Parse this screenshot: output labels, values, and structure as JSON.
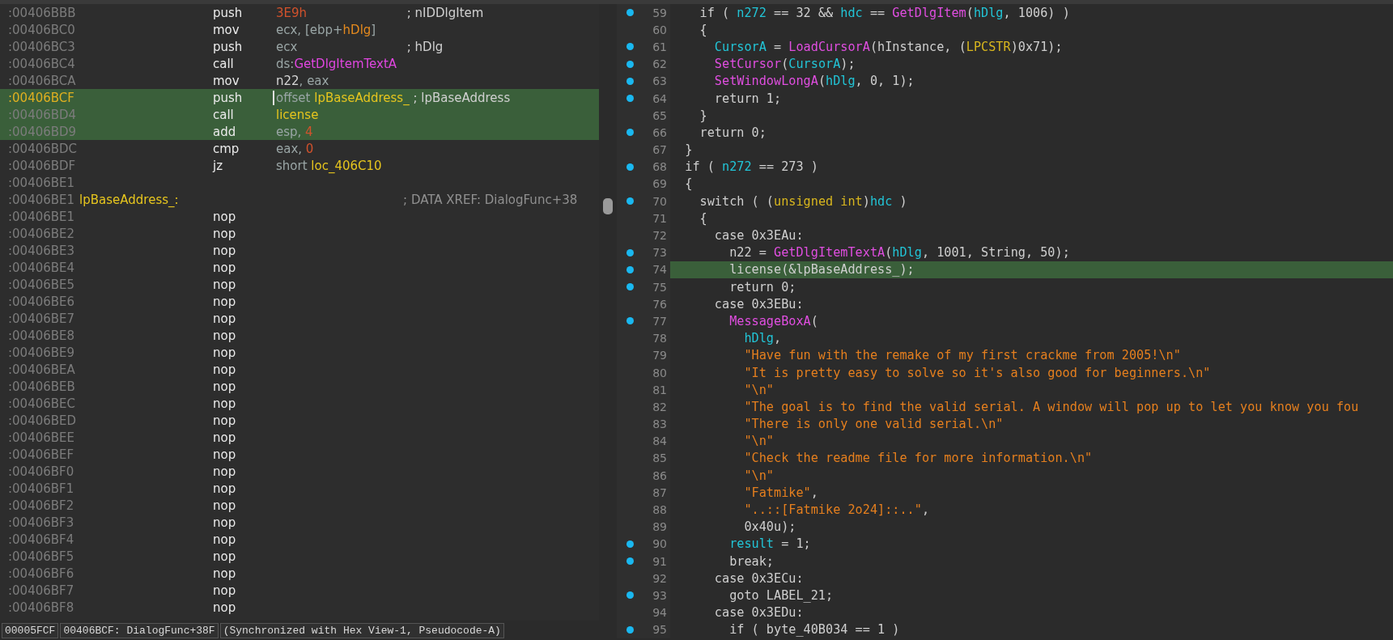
{
  "disassembly": {
    "rows": [
      {
        "address": ":00406BBB",
        "current": false,
        "selected": false,
        "caret": false,
        "mnemonic": "push",
        "operands": [
          {
            "kind": "num",
            "text": "3E9h"
          }
        ],
        "comment": "; nIDDlgItem"
      },
      {
        "address": ":00406BC0",
        "current": false,
        "selected": false,
        "caret": false,
        "mnemonic": "mov",
        "operands": [
          {
            "kind": "reg",
            "text": "ecx, [ebp+"
          },
          {
            "kind": "arg",
            "text": "hDlg"
          },
          {
            "kind": "reg",
            "text": "]"
          }
        ]
      },
      {
        "address": ":00406BC3",
        "current": false,
        "selected": false,
        "caret": false,
        "mnemonic": "push",
        "operands": [
          {
            "kind": "reg",
            "text": "ecx"
          }
        ],
        "comment": "; hDlg"
      },
      {
        "address": ":00406BC4",
        "current": false,
        "selected": false,
        "caret": false,
        "mnemonic": "call",
        "operands": [
          {
            "kind": "reg",
            "text": "ds:"
          },
          {
            "kind": "func",
            "text": "GetDlgItemTextA"
          }
        ]
      },
      {
        "address": ":00406BCA",
        "current": false,
        "selected": false,
        "caret": false,
        "mnemonic": "mov",
        "operands": [
          {
            "kind": "plain",
            "text": "n22"
          },
          {
            "kind": "reg",
            "text": ", eax"
          }
        ]
      },
      {
        "address": ":00406BCF",
        "current": true,
        "selected": true,
        "caret": true,
        "mnemonic": "push",
        "operands": [
          {
            "kind": "reg",
            "text": "offset "
          },
          {
            "kind": "name",
            "text": "lpBaseAddress_"
          }
        ],
        "comment": "; lpBaseAddress"
      },
      {
        "address": ":00406BD4",
        "current": false,
        "selected": true,
        "caret": false,
        "mnemonic": "call",
        "operands": [
          {
            "kind": "name",
            "text": "license"
          }
        ]
      },
      {
        "address": ":00406BD9",
        "current": false,
        "selected": true,
        "caret": false,
        "mnemonic": "add",
        "operands": [
          {
            "kind": "reg",
            "text": "esp, "
          },
          {
            "kind": "num",
            "text": "4"
          }
        ]
      },
      {
        "address": ":00406BDC",
        "current": false,
        "selected": false,
        "caret": false,
        "mnemonic": "cmp",
        "operands": [
          {
            "kind": "reg",
            "text": "eax, "
          },
          {
            "kind": "num",
            "text": "0"
          }
        ]
      },
      {
        "address": ":00406BDF",
        "current": false,
        "selected": false,
        "caret": false,
        "mnemonic": "jz",
        "operands": [
          {
            "kind": "reg",
            "text": "short "
          },
          {
            "kind": "name",
            "text": "loc_406C10"
          }
        ]
      },
      {
        "address": ":00406BE1",
        "current": false,
        "selected": false,
        "caret": false
      },
      {
        "address": ":00406BE1",
        "current": false,
        "selected": false,
        "caret": false,
        "label": "lpBaseAddress_:",
        "comment": "; DATA XREF: DialogFunc+38"
      },
      {
        "address": ":00406BE1",
        "current": false,
        "selected": false,
        "caret": false,
        "mnemonic": "nop"
      },
      {
        "address": ":00406BE2",
        "current": false,
        "selected": false,
        "caret": false,
        "mnemonic": "nop"
      },
      {
        "address": ":00406BE3",
        "current": false,
        "selected": false,
        "caret": false,
        "mnemonic": "nop"
      },
      {
        "address": ":00406BE4",
        "current": false,
        "selected": false,
        "caret": false,
        "mnemonic": "nop"
      },
      {
        "address": ":00406BE5",
        "current": false,
        "selected": false,
        "caret": false,
        "mnemonic": "nop"
      },
      {
        "address": ":00406BE6",
        "current": false,
        "selected": false,
        "caret": false,
        "mnemonic": "nop"
      },
      {
        "address": ":00406BE7",
        "current": false,
        "selected": false,
        "caret": false,
        "mnemonic": "nop"
      },
      {
        "address": ":00406BE8",
        "current": false,
        "selected": false,
        "caret": false,
        "mnemonic": "nop"
      },
      {
        "address": ":00406BE9",
        "current": false,
        "selected": false,
        "caret": false,
        "mnemonic": "nop"
      },
      {
        "address": ":00406BEA",
        "current": false,
        "selected": false,
        "caret": false,
        "mnemonic": "nop"
      },
      {
        "address": ":00406BEB",
        "current": false,
        "selected": false,
        "caret": false,
        "mnemonic": "nop"
      },
      {
        "address": ":00406BEC",
        "current": false,
        "selected": false,
        "caret": false,
        "mnemonic": "nop"
      },
      {
        "address": ":00406BED",
        "current": false,
        "selected": false,
        "caret": false,
        "mnemonic": "nop"
      },
      {
        "address": ":00406BEE",
        "current": false,
        "selected": false,
        "caret": false,
        "mnemonic": "nop"
      },
      {
        "address": ":00406BEF",
        "current": false,
        "selected": false,
        "caret": false,
        "mnemonic": "nop"
      },
      {
        "address": ":00406BF0",
        "current": false,
        "selected": false,
        "caret": false,
        "mnemonic": "nop"
      },
      {
        "address": ":00406BF1",
        "current": false,
        "selected": false,
        "caret": false,
        "mnemonic": "nop"
      },
      {
        "address": ":00406BF2",
        "current": false,
        "selected": false,
        "caret": false,
        "mnemonic": "nop"
      },
      {
        "address": ":00406BF3",
        "current": false,
        "selected": false,
        "caret": false,
        "mnemonic": "nop"
      },
      {
        "address": ":00406BF4",
        "current": false,
        "selected": false,
        "caret": false,
        "mnemonic": "nop"
      },
      {
        "address": ":00406BF5",
        "current": false,
        "selected": false,
        "caret": false,
        "mnemonic": "nop"
      },
      {
        "address": ":00406BF6",
        "current": false,
        "selected": false,
        "caret": false,
        "mnemonic": "nop"
      },
      {
        "address": ":00406BF7",
        "current": false,
        "selected": false,
        "caret": false,
        "mnemonic": "nop"
      },
      {
        "address": ":00406BF8",
        "current": false,
        "selected": false,
        "caret": false,
        "mnemonic": "nop"
      }
    ],
    "status_bar": [
      "00005FCF",
      "00406BCF: DialogFunc+38F",
      "(Synchronized with Hex View-1, Pseudocode-A)"
    ]
  },
  "pseudocode": {
    "lines": [
      {
        "number": "59",
        "dot": true,
        "selected": false,
        "tokens": [
          {
            "kind": "plain",
            "text": "    if ( "
          },
          {
            "kind": "var",
            "text": "n272"
          },
          {
            "kind": "plain",
            "text": " == 32 && "
          },
          {
            "kind": "var",
            "text": "hdc"
          },
          {
            "kind": "plain",
            "text": " == "
          },
          {
            "kind": "func",
            "text": "GetDlgItem"
          },
          {
            "kind": "plain",
            "text": "("
          },
          {
            "kind": "var",
            "text": "hDlg"
          },
          {
            "kind": "plain",
            "text": ", 1006) )"
          }
        ]
      },
      {
        "number": "60",
        "dot": false,
        "selected": false,
        "tokens": [
          {
            "kind": "plain",
            "text": "    {"
          }
        ]
      },
      {
        "number": "61",
        "dot": true,
        "selected": false,
        "tokens": [
          {
            "kind": "var",
            "text": "      CursorA"
          },
          {
            "kind": "plain",
            "text": " = "
          },
          {
            "kind": "func",
            "text": "LoadCursorA"
          },
          {
            "kind": "plain",
            "text": "(hInstance, ("
          },
          {
            "kind": "type",
            "text": "LPCSTR"
          },
          {
            "kind": "plain",
            "text": ")0x71);"
          }
        ]
      },
      {
        "number": "62",
        "dot": true,
        "selected": false,
        "tokens": [
          {
            "kind": "func",
            "text": "      SetCursor"
          },
          {
            "kind": "plain",
            "text": "("
          },
          {
            "kind": "var",
            "text": "CursorA"
          },
          {
            "kind": "plain",
            "text": ");"
          }
        ]
      },
      {
        "number": "63",
        "dot": true,
        "selected": false,
        "tokens": [
          {
            "kind": "func",
            "text": "      SetWindowLongA"
          },
          {
            "kind": "plain",
            "text": "("
          },
          {
            "kind": "var",
            "text": "hDlg"
          },
          {
            "kind": "plain",
            "text": ", 0, 1);"
          }
        ]
      },
      {
        "number": "64",
        "dot": true,
        "selected": false,
        "tokens": [
          {
            "kind": "plain",
            "text": "      return 1;"
          }
        ]
      },
      {
        "number": "65",
        "dot": false,
        "selected": false,
        "tokens": [
          {
            "kind": "plain",
            "text": "    }"
          }
        ]
      },
      {
        "number": "66",
        "dot": true,
        "selected": false,
        "tokens": [
          {
            "kind": "plain",
            "text": "    return 0;"
          }
        ]
      },
      {
        "number": "67",
        "dot": false,
        "selected": false,
        "tokens": [
          {
            "kind": "plain",
            "text": "  }"
          }
        ]
      },
      {
        "number": "68",
        "dot": true,
        "selected": false,
        "tokens": [
          {
            "kind": "plain",
            "text": "  if ( "
          },
          {
            "kind": "var",
            "text": "n272"
          },
          {
            "kind": "plain",
            "text": " == 273 )"
          }
        ]
      },
      {
        "number": "69",
        "dot": false,
        "selected": false,
        "tokens": [
          {
            "kind": "plain",
            "text": "  {"
          }
        ]
      },
      {
        "number": "70",
        "dot": true,
        "selected": false,
        "tokens": [
          {
            "kind": "plain",
            "text": "    switch ( ("
          },
          {
            "kind": "type",
            "text": "unsigned int"
          },
          {
            "kind": "plain",
            "text": ")"
          },
          {
            "kind": "var",
            "text": "hdc"
          },
          {
            "kind": "plain",
            "text": " )"
          }
        ]
      },
      {
        "number": "71",
        "dot": false,
        "selected": false,
        "tokens": [
          {
            "kind": "plain",
            "text": "    {"
          }
        ]
      },
      {
        "number": "72",
        "dot": false,
        "selected": false,
        "tokens": [
          {
            "kind": "plain",
            "text": "      case 0x3EAu:"
          }
        ]
      },
      {
        "number": "73",
        "dot": true,
        "selected": false,
        "tokens": [
          {
            "kind": "plain",
            "text": "        n22 = "
          },
          {
            "kind": "func",
            "text": "GetDlgItemTextA"
          },
          {
            "kind": "plain",
            "text": "("
          },
          {
            "kind": "var",
            "text": "hDlg"
          },
          {
            "kind": "plain",
            "text": ", 1001, String, 50);"
          }
        ]
      },
      {
        "number": "74",
        "dot": true,
        "selected": true,
        "tokens": [
          {
            "kind": "plain",
            "text": "        license(&lpBaseAddress_);"
          }
        ]
      },
      {
        "number": "75",
        "dot": true,
        "selected": false,
        "tokens": [
          {
            "kind": "plain",
            "text": "        return 0;"
          }
        ]
      },
      {
        "number": "76",
        "dot": false,
        "selected": false,
        "tokens": [
          {
            "kind": "plain",
            "text": "      case 0x3EBu:"
          }
        ]
      },
      {
        "number": "77",
        "dot": true,
        "selected": false,
        "tokens": [
          {
            "kind": "func",
            "text": "        MessageBoxA"
          },
          {
            "kind": "plain",
            "text": "("
          }
        ]
      },
      {
        "number": "78",
        "dot": false,
        "selected": false,
        "tokens": [
          {
            "kind": "var",
            "text": "          hDlg"
          },
          {
            "kind": "plain",
            "text": ","
          }
        ]
      },
      {
        "number": "79",
        "dot": false,
        "selected": false,
        "tokens": [
          {
            "kind": "str",
            "text": "          \"Have fun with the remake of my first crackme from 2005!\\n\""
          }
        ]
      },
      {
        "number": "80",
        "dot": false,
        "selected": false,
        "tokens": [
          {
            "kind": "str",
            "text": "          \"It is pretty easy to solve so it's also good for beginners.\\n\""
          }
        ]
      },
      {
        "number": "81",
        "dot": false,
        "selected": false,
        "tokens": [
          {
            "kind": "str",
            "text": "          \"\\n\""
          }
        ]
      },
      {
        "number": "82",
        "dot": false,
        "selected": false,
        "tokens": [
          {
            "kind": "str",
            "text": "          \"The goal is to find the valid serial. A window will pop up to let you know you fou"
          }
        ]
      },
      {
        "number": "83",
        "dot": false,
        "selected": false,
        "tokens": [
          {
            "kind": "str",
            "text": "          \"There is only one valid serial.\\n\""
          }
        ]
      },
      {
        "number": "84",
        "dot": false,
        "selected": false,
        "tokens": [
          {
            "kind": "str",
            "text": "          \"\\n\""
          }
        ]
      },
      {
        "number": "85",
        "dot": false,
        "selected": false,
        "tokens": [
          {
            "kind": "str",
            "text": "          \"Check the readme file for more information.\\n\""
          }
        ]
      },
      {
        "number": "86",
        "dot": false,
        "selected": false,
        "tokens": [
          {
            "kind": "str",
            "text": "          \"\\n\""
          }
        ]
      },
      {
        "number": "87",
        "dot": false,
        "selected": false,
        "tokens": [
          {
            "kind": "str",
            "text": "          \"Fatmike\""
          },
          {
            "kind": "plain",
            "text": ","
          }
        ]
      },
      {
        "number": "88",
        "dot": false,
        "selected": false,
        "tokens": [
          {
            "kind": "str",
            "text": "          \"..::[Fatmike 2o24]::..\""
          },
          {
            "kind": "plain",
            "text": ","
          }
        ]
      },
      {
        "number": "89",
        "dot": false,
        "selected": false,
        "tokens": [
          {
            "kind": "plain",
            "text": "          0x40u);"
          }
        ]
      },
      {
        "number": "90",
        "dot": true,
        "selected": false,
        "tokens": [
          {
            "kind": "var",
            "text": "        result"
          },
          {
            "kind": "plain",
            "text": " = 1;"
          }
        ]
      },
      {
        "number": "91",
        "dot": true,
        "selected": false,
        "tokens": [
          {
            "kind": "plain",
            "text": "        break;"
          }
        ]
      },
      {
        "number": "92",
        "dot": false,
        "selected": false,
        "tokens": [
          {
            "kind": "plain",
            "text": "      case 0x3ECu:"
          }
        ]
      },
      {
        "number": "93",
        "dot": true,
        "selected": false,
        "tokens": [
          {
            "kind": "plain",
            "text": "        goto LABEL_21;"
          }
        ]
      },
      {
        "number": "94",
        "dot": false,
        "selected": false,
        "tokens": [
          {
            "kind": "plain",
            "text": "      case 0x3EDu:"
          }
        ]
      },
      {
        "number": "95",
        "dot": true,
        "selected": false,
        "tokens": [
          {
            "kind": "plain",
            "text": "        if ( byte_40B034 == 1 )"
          }
        ]
      }
    ]
  }
}
